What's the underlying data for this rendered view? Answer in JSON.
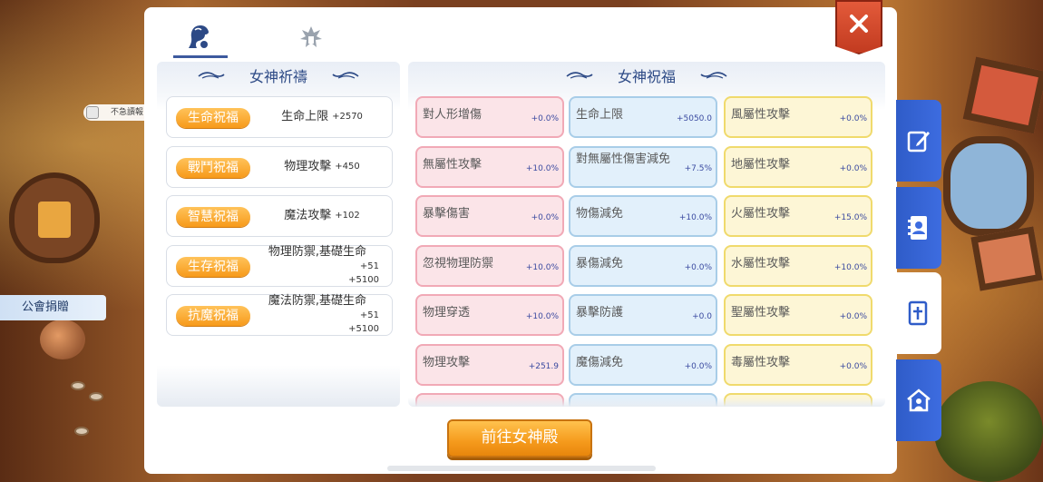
{
  "background": {
    "side_chip_text": "不急讀報",
    "guild_label": "公會捐贈"
  },
  "tabs": [
    {
      "name": "goddess",
      "icon": "goddess-head-icon",
      "active": true
    },
    {
      "name": "emblem",
      "icon": "emblem-icon",
      "active": false
    }
  ],
  "prayer": {
    "title": "女神祈禱",
    "items": [
      {
        "label": "生命祝福",
        "stat": "生命上限",
        "value": "+2570"
      },
      {
        "label": "戰鬥祝福",
        "stat": "物理攻擊",
        "value": "+450"
      },
      {
        "label": "智慧祝福",
        "stat": "魔法攻擊",
        "value": "+102"
      },
      {
        "label": "生存祝福",
        "stat": "物理防禦,基礎生命",
        "value": "+51\n+5100"
      },
      {
        "label": "抗魔祝福",
        "stat": "魔法防禦,基礎生命",
        "value": "+51\n+5100"
      }
    ]
  },
  "blessing": {
    "title": "女神祝福",
    "columns": [
      {
        "color": "pink",
        "cells": [
          {
            "name": "對人形增傷",
            "value": "+0.0%"
          },
          {
            "name": "無屬性攻擊",
            "value": "+10.0%"
          },
          {
            "name": "暴擊傷害",
            "value": "+0.0%"
          },
          {
            "name": "忽視物理防禦",
            "value": "+10.0%"
          },
          {
            "name": "物理穿透",
            "value": "+10.0%"
          },
          {
            "name": "物理攻擊",
            "value": "+251.9"
          }
        ]
      },
      {
        "color": "blue",
        "cells": [
          {
            "name": "生命上限",
            "value": "+5050.0"
          },
          {
            "name": "對無屬性傷害減免",
            "value": "+7.5%"
          },
          {
            "name": "物傷減免",
            "value": "+10.0%"
          },
          {
            "name": "暴傷減免",
            "value": "+0.0%"
          },
          {
            "name": "暴擊防護",
            "value": "+0.0"
          },
          {
            "name": "魔傷減免",
            "value": "+0.0%"
          }
        ]
      },
      {
        "color": "yellow",
        "cells": [
          {
            "name": "風屬性攻擊",
            "value": "+0.0%"
          },
          {
            "name": "地屬性攻擊",
            "value": "+0.0%"
          },
          {
            "name": "火屬性攻擊",
            "value": "+15.0%"
          },
          {
            "name": "水屬性攻擊",
            "value": "+10.0%"
          },
          {
            "name": "聖屬性攻擊",
            "value": "+0.0%"
          },
          {
            "name": "毒屬性攻擊",
            "value": "+0.0%"
          }
        ]
      }
    ]
  },
  "go_button": "前往女神殿",
  "side_tabs": [
    {
      "icon": "edit-icon",
      "active": false
    },
    {
      "icon": "contacts-book-icon",
      "active": false
    },
    {
      "icon": "cross-book-icon",
      "active": true
    },
    {
      "icon": "guild-house-icon",
      "active": false
    }
  ],
  "colors": {
    "accent_blue": "#2d4a86",
    "pill_orange": "#f79a1a",
    "close_red": "#d9482a",
    "side_tab_blue": "#3d6ce0"
  }
}
